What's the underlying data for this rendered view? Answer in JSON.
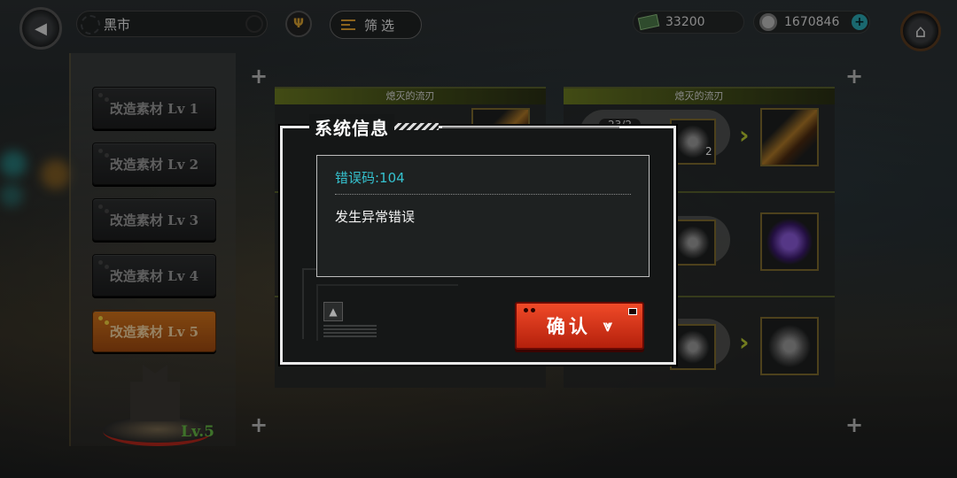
{
  "topbar": {
    "back_icon": "back-arrow-icon",
    "title": "黑市",
    "faction_icon": "faction-emblem-icon",
    "filter_label": "筛选",
    "filter_icon": "filter-lines-icon",
    "cash_amount": "33200",
    "cash_icon": "cash-icon",
    "gear_amount": "1670846",
    "gear_icon": "gear-coin-icon",
    "add_label": "+",
    "home_icon": "home-icon"
  },
  "sidebar": {
    "items": [
      {
        "label": "改造素材 Lv 1",
        "active": false
      },
      {
        "label": "改造素材 Lv 2",
        "active": false
      },
      {
        "label": "改造素材 Lv 3",
        "active": false
      },
      {
        "label": "改造素材 Lv 4",
        "active": false
      },
      {
        "label": "改造素材 Lv 5",
        "active": true
      }
    ],
    "shop_level": "Lv.5"
  },
  "cards": {
    "card1_title": "熄灭的流刃",
    "card2_title": "熄灭的流刃",
    "card2_counter": "23/2",
    "card2_qty": "2",
    "arrow": "›"
  },
  "dialog": {
    "title": "系统信息",
    "error_code": "错误码:104",
    "message": "发生异常错误",
    "confirm_label": "确认",
    "confirm_icon": "double-chevron-down-icon"
  },
  "colors": {
    "accent_cyan": "#35c2cf",
    "confirm_red": "#e03a1c",
    "active_orange": "#d3751c",
    "level_green": "#64b844"
  }
}
